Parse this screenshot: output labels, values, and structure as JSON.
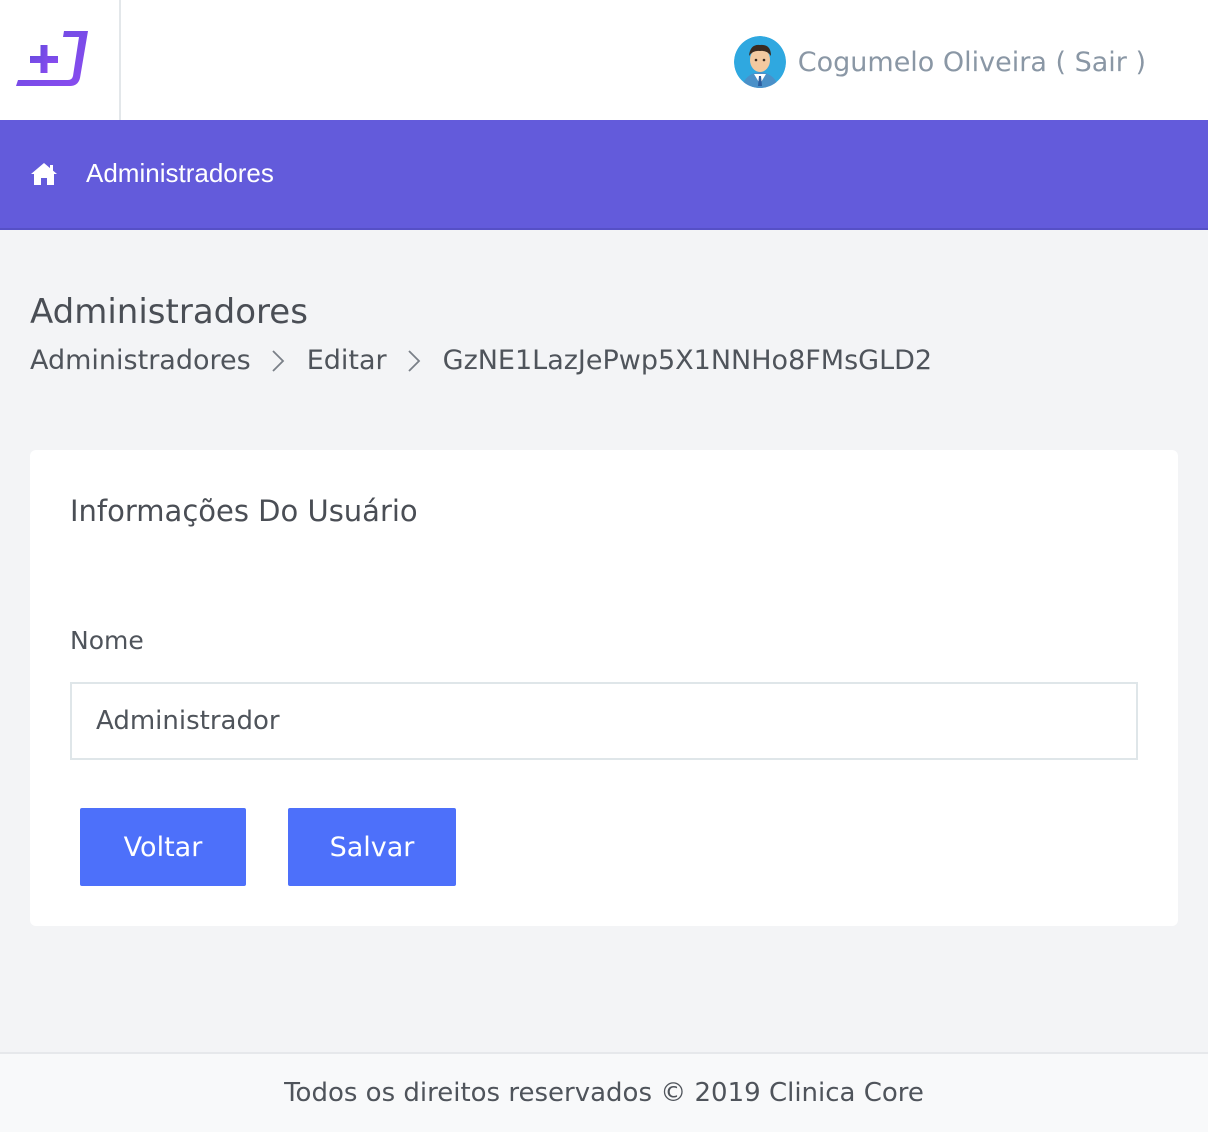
{
  "header": {
    "user_name": "Cogumelo Oliveira ( Sair )"
  },
  "nav": {
    "title": "Administradores"
  },
  "page": {
    "title": "Administradores",
    "breadcrumb": [
      "Administradores",
      "Editar",
      "GzNE1LazJePwp5X1NNHo8FMsGLD2"
    ]
  },
  "card": {
    "title": "Informações Do Usuário",
    "name_label": "Nome",
    "name_value": "Administrador",
    "back_label": "Voltar",
    "save_label": "Salvar"
  },
  "footer": {
    "text": "Todos os direitos reservados © 2019 Clinica Core"
  },
  "colors": {
    "brand": "#635bdb",
    "button": "#4d70fa"
  },
  "icons": [
    "app-logo-icon",
    "user-avatar",
    "home-icon",
    "chevron-right-icon"
  ]
}
